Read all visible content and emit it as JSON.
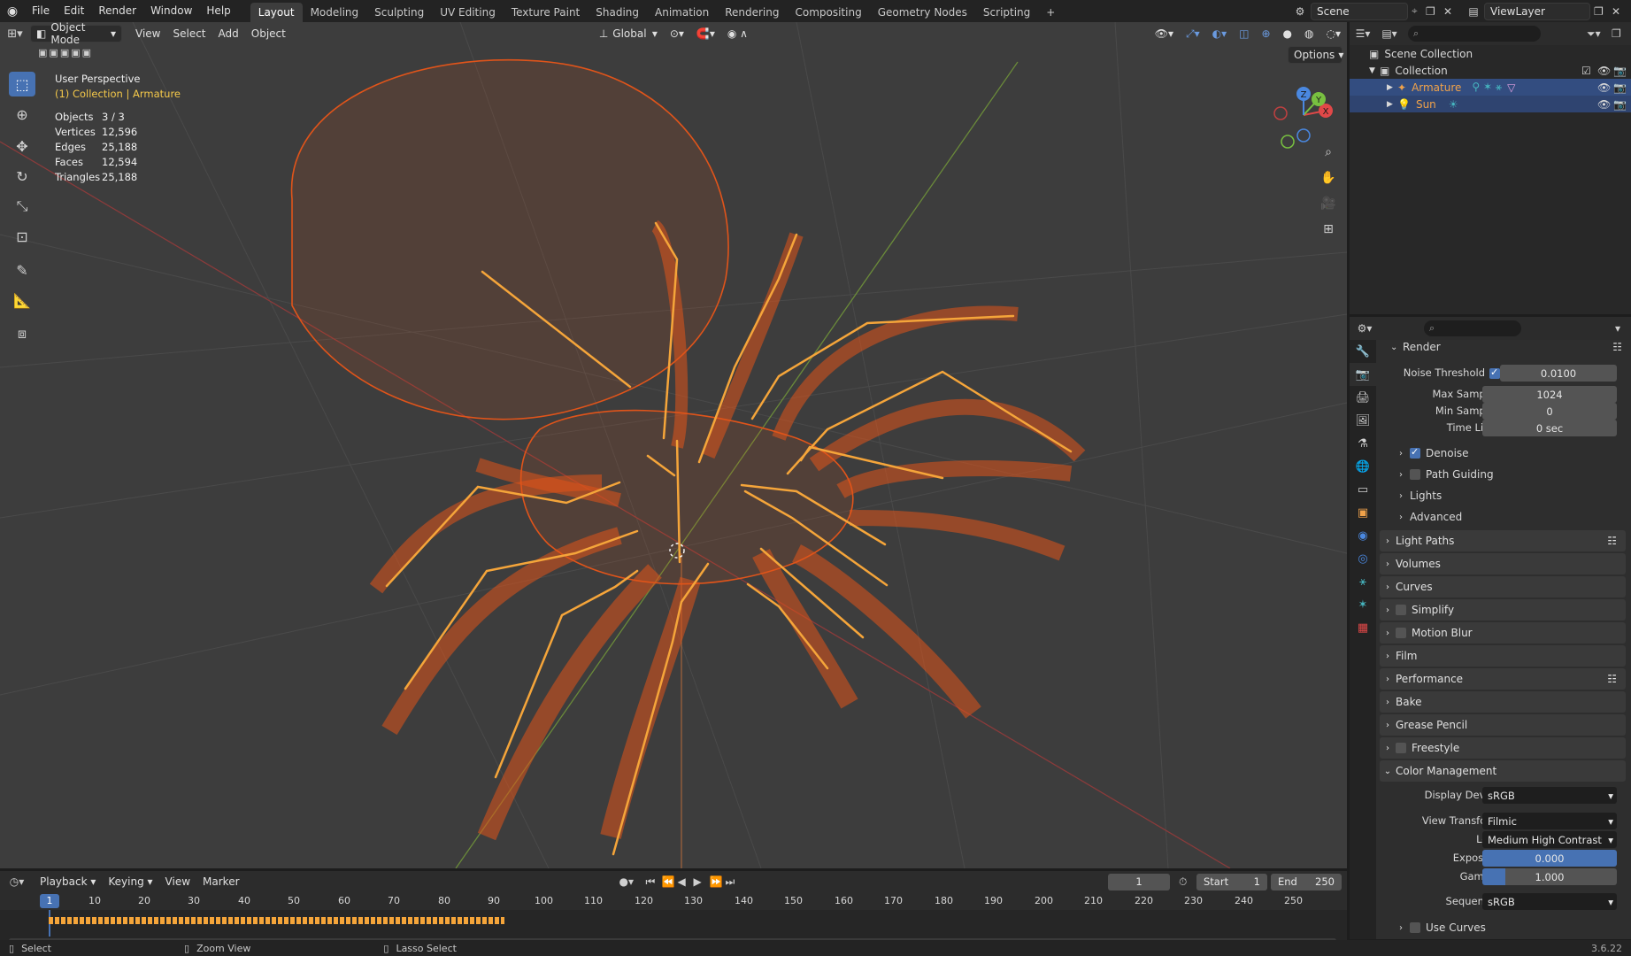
{
  "menu": [
    "File",
    "Edit",
    "Render",
    "Window",
    "Help"
  ],
  "workspaces": [
    "Layout",
    "Modeling",
    "Sculpting",
    "UV Editing",
    "Texture Paint",
    "Shading",
    "Animation",
    "Rendering",
    "Compositing",
    "Geometry Nodes",
    "Scripting"
  ],
  "add_tab": "+",
  "scene": "Scene",
  "view_layer": "ViewLayer",
  "viewport": {
    "mode": "Object Mode",
    "menus": [
      "View",
      "Select",
      "Add",
      "Object"
    ],
    "orientation": "Global",
    "options_label": "Options",
    "perspective": "User Perspective",
    "collection_line": "(1) Collection | Armature",
    "stats": [
      {
        "label": "Objects",
        "value": "3 / 3"
      },
      {
        "label": "Vertices",
        "value": "12,596"
      },
      {
        "label": "Edges",
        "value": "25,188"
      },
      {
        "label": "Faces",
        "value": "12,594"
      },
      {
        "label": "Triangles",
        "value": "25,188"
      }
    ],
    "gizmo": {
      "x": "X",
      "y": "Y",
      "z": "Z"
    }
  },
  "outliner": {
    "scene_collection": "Scene Collection",
    "collection": "Collection",
    "items": [
      "Armature",
      "Sun"
    ]
  },
  "properties": {
    "render_section": "Render",
    "noise_threshold_label": "Noise Threshold",
    "noise_threshold_value": "0.0100",
    "max_samples_label": "Max Samples",
    "max_samples_value": "1024",
    "min_samples_label": "Min Samples",
    "min_samples_value": "0",
    "time_limit_label": "Time Limit",
    "time_limit_value": "0 sec",
    "sub_panels": [
      "Denoise",
      "Path Guiding",
      "Lights",
      "Advanced"
    ],
    "panels": [
      "Light Paths",
      "Volumes",
      "Curves",
      "Simplify",
      "Motion Blur",
      "Film",
      "Performance",
      "Bake",
      "Grease Pencil",
      "Freestyle"
    ],
    "color_management": "Color Management",
    "display_device_label": "Display Device",
    "display_device_value": "sRGB",
    "view_transform_label": "View Transform",
    "view_transform_value": "Filmic",
    "look_label": "Look",
    "look_value": "Medium High Contrast",
    "exposure_label": "Exposure",
    "exposure_value": "0.000",
    "gamma_label": "Gamma",
    "gamma_value": "1.000",
    "sequencer_label": "Sequencer",
    "sequencer_value": "sRGB",
    "use_curves": "Use Curves"
  },
  "timeline": {
    "menus": [
      "Playback",
      "Keying",
      "View",
      "Marker"
    ],
    "current_frame": "1",
    "start_label": "Start",
    "start_value": "1",
    "end_label": "End",
    "end_value": "250",
    "ruler": [
      "10",
      "20",
      "30",
      "40",
      "50",
      "60",
      "70",
      "80",
      "90",
      "100",
      "110",
      "120",
      "130",
      "140",
      "150",
      "160",
      "170",
      "180",
      "190",
      "200",
      "210",
      "220",
      "230",
      "240",
      "250"
    ],
    "playhead": "1"
  },
  "status": {
    "select": "Select",
    "zoom": "Zoom View",
    "lasso": "Lasso Select",
    "version": "3.6.22"
  },
  "colors": {
    "accent": "#4772b3",
    "wire": "#e0541a",
    "bone": "#f5a53a",
    "selected_text": "#f0a24a"
  }
}
